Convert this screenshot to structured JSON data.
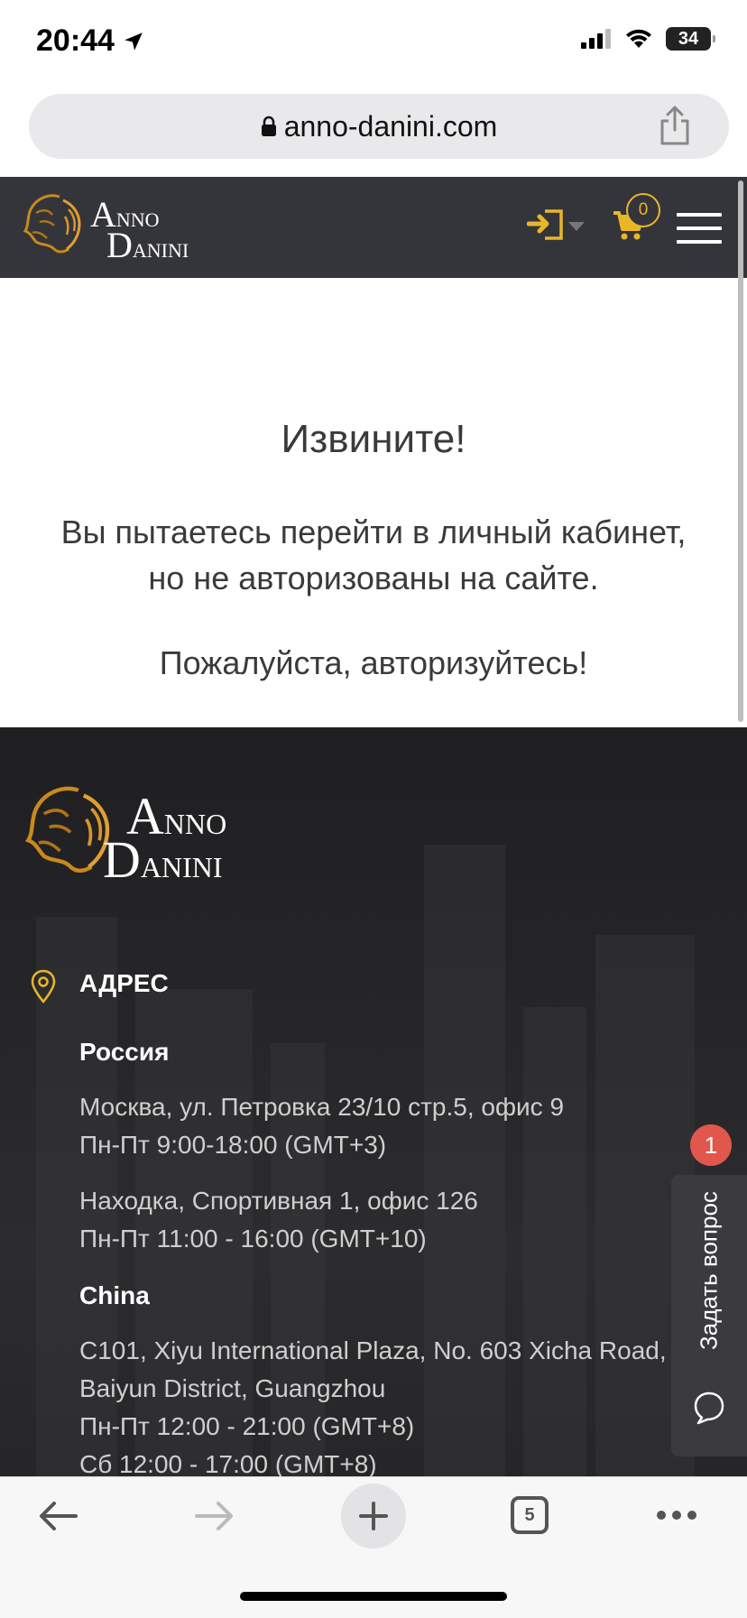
{
  "status_bar": {
    "time": "20:44",
    "battery": "34"
  },
  "browser": {
    "url": "anno-danini.com",
    "tabs_count": "5"
  },
  "header": {
    "logo_line1": "Anno",
    "logo_line2": "Danini",
    "cart_count": "0"
  },
  "main": {
    "title": "Извините!",
    "message_line1": "Вы пытаетесь перейти в личный кабинет,",
    "message_line2": "но не авторизованы на сайте.",
    "message_action": "Пожалуйста, авторизуйтесь!"
  },
  "footer": {
    "logo_line1": "Anno",
    "logo_line2": "Danini",
    "address_heading": "АДРЕС",
    "country_russia": "Россия",
    "moscow_address": "Москва, ул. Петровка 23/10 стр.5, офис 9",
    "moscow_hours": "Пн-Пт 9:00-18:00 (GMT+3)",
    "nakhodka_address": "Находка, Спортивная 1, офис 126",
    "nakhodka_hours": "Пн-Пт 11:00 - 16:00 (GMT+10)",
    "country_china": "China",
    "china_address_line1": "C101, Xiyu International Plaza, No. 603 Xicha Road,",
    "china_address_line2": "Baiyun District, Guangzhou",
    "china_hours_weekdays": "Пн-Пт 12:00 - 21:00 (GMT+8)",
    "china_hours_saturday": "Сб 12:00 - 17:00 (GMT+8)"
  },
  "chat_widget": {
    "label": "Задать вопрос",
    "notification_count": "1"
  },
  "colors": {
    "accent": "#e9b62a",
    "header_bg": "#34353a",
    "notification": "#e1574b"
  }
}
